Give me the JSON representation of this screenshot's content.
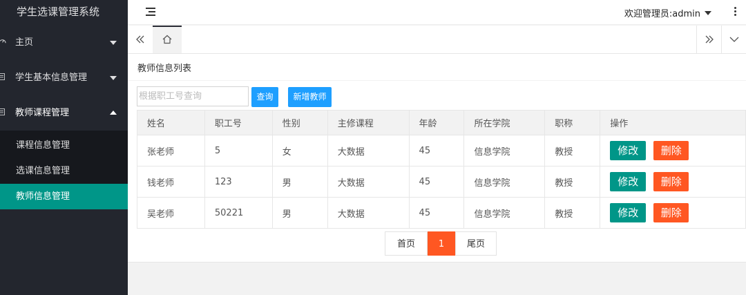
{
  "app": {
    "title": "学生选课管理系统"
  },
  "sidebar": {
    "items": [
      {
        "label": "主页",
        "icon": "gauge-icon"
      },
      {
        "label": "学生基本信息管理",
        "icon": "document-icon"
      },
      {
        "label": "教师课程管理",
        "icon": "document-icon",
        "expanded": true
      }
    ],
    "submenu": [
      {
        "label": "课程信息管理",
        "active": false
      },
      {
        "label": "选课信息管理",
        "active": false
      },
      {
        "label": "教师信息管理",
        "active": true
      }
    ]
  },
  "header": {
    "user_label": "欢迎管理员:admin"
  },
  "panel": {
    "title": "教师信息列表"
  },
  "search": {
    "placeholder": "根据职工号查询",
    "query_label": "查询",
    "add_label": "新增教师"
  },
  "table": {
    "headers": [
      "姓名",
      "职工号",
      "性别",
      "主修课程",
      "年龄",
      "所在学院",
      "职称",
      "操作"
    ],
    "rows": [
      [
        "张老师",
        "5",
        "女",
        "大数据",
        "45",
        "信息学院",
        "教授"
      ],
      [
        "钱老师",
        "123",
        "男",
        "大数据",
        "45",
        "信息学院",
        "教授"
      ],
      [
        "吴老师",
        "50221",
        "男",
        "大数据",
        "45",
        "信息学院",
        "教授"
      ]
    ],
    "edit_label": "修改",
    "delete_label": "删除"
  },
  "pagination": {
    "first_label": "首页",
    "current": "1",
    "last_label": "尾页"
  },
  "colors": {
    "sidebar_bg": "#23262e",
    "active": "#009688",
    "primary_blue": "#1e9fff",
    "danger": "#ff5722"
  }
}
